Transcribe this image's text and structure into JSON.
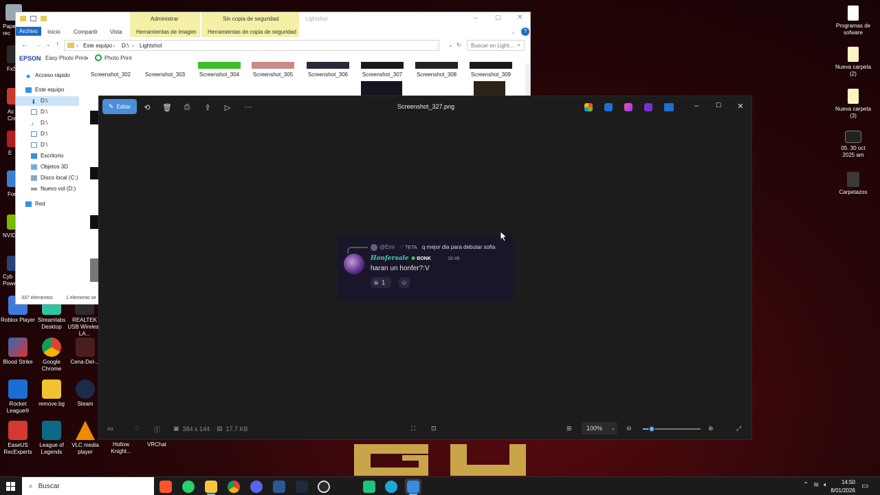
{
  "desktop": {
    "left_icons": [
      {
        "label": "Roblox Player"
      },
      {
        "label": "Streamlabs Desktop"
      },
      {
        "label": "REALTEK USB Wireless LA..."
      },
      {
        "label": "Blood Strike"
      },
      {
        "label": "Google Chrome"
      },
      {
        "label": "Cena-Del-..."
      },
      {
        "label": "Rocket League®"
      },
      {
        "label": "remove.bg"
      },
      {
        "label": "Steam"
      },
      {
        "label": "EaseUS RecExperts"
      },
      {
        "label": "League of Legends"
      },
      {
        "label": "VLC media player"
      },
      {
        "label": "Hollow Knight..."
      },
      {
        "label": "VRChat"
      }
    ],
    "left_edge_labels": [
      "Pape rec",
      "FxS",
      "Ac Cre",
      "E",
      "For",
      "NVID",
      "Cyb Powe"
    ],
    "right_icons": [
      {
        "label": "Programas de sofware"
      },
      {
        "label": "Nueva carpeta (2)"
      },
      {
        "label": "Nueva carpeta (3)"
      },
      {
        "label": "05. 30 oct 2025 am"
      },
      {
        "label": "Carpetazos"
      }
    ]
  },
  "explorer": {
    "title": "Lightshot",
    "ribbon_context": [
      "Administrar",
      "Sin copia de seguridad"
    ],
    "ribbon_tabs": [
      "Archivo",
      "Inicio",
      "Compartir",
      "Vista",
      "Herramientas de imagen",
      "Herramientas de copia de seguridad"
    ],
    "address": [
      "Este equipo",
      "D:\\",
      "Lightshot"
    ],
    "search_placeholder": "Buscar en Light...",
    "toolbar": {
      "brand": "EPSON",
      "easy_photo": "Easy Photo Print",
      "photo_print": "Photo Print"
    },
    "nav": [
      {
        "label": "Acceso rápido"
      },
      {
        "label": "Este equipo"
      },
      {
        "label": "D:\\"
      },
      {
        "label": "D:\\"
      },
      {
        "label": "D:\\"
      },
      {
        "label": "D:\\"
      },
      {
        "label": "D:\\"
      },
      {
        "label": "Escritorio"
      },
      {
        "label": "Objetos 3D"
      },
      {
        "label": "Disco local (C:)"
      },
      {
        "label": "Nuevo vol (D:)"
      },
      {
        "label": "Red"
      }
    ],
    "thumbs": [
      "Screenshot_302",
      "Screenshot_303",
      "Screenshot_304",
      "Screenshot_305",
      "Screenshot_306",
      "Screenshot_307",
      "Screenshot_308",
      "Screenshot_309"
    ],
    "status": {
      "count": "337 elementos",
      "selected": "1 elemento se"
    }
  },
  "viewer": {
    "edit_label": "Editar",
    "filename": "Screenshot_327.png",
    "dimensions": "384 x 144",
    "filesize": "17.7 KB",
    "zoom": "100%",
    "zoom_fraction": 0.15,
    "shot": {
      "reply_user": "@Emi",
      "reply_tag": "TETA",
      "reply_text": "q mejor dia para debutar sofia",
      "author": "Honfersale",
      "author_tag": "BONK",
      "time": "16:48",
      "message": "haran un honfer?:V",
      "reaction_count": "1"
    }
  },
  "taskbar": {
    "search_placeholder": "Buscar",
    "clock_time": "14:50",
    "clock_date": "8/01/2026"
  }
}
